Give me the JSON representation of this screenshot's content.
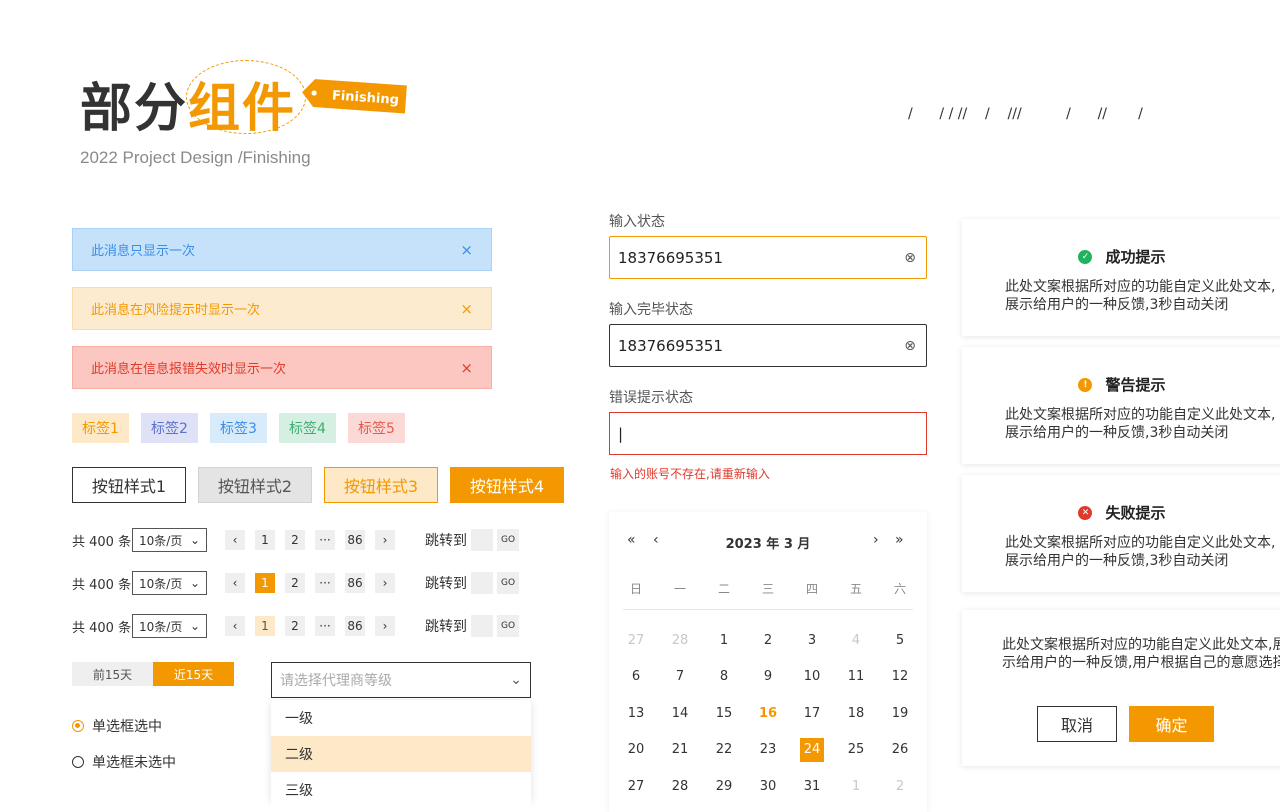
{
  "header": {
    "title_dark": "部分",
    "title_orange": "组件",
    "tag_label": "Finishing",
    "subtitle": "2022 Project Design /Finishing",
    "slashes": "/      / / //    /    ///          /      //       /"
  },
  "alerts": [
    {
      "text": "此消息只显示一次",
      "close": "×"
    },
    {
      "text": "此消息在风险提示时显示一次",
      "close": "×"
    },
    {
      "text": "此消息在信息报错失效时显示一次",
      "close": "×"
    }
  ],
  "tags": [
    "标签1",
    "标签2",
    "标签3",
    "标签4",
    "标签5"
  ],
  "buttons": [
    "按钮样式1",
    "按钮样式2",
    "按钮样式3",
    "按钮样式4"
  ],
  "pagination": {
    "total": "共 400 条",
    "page_size": "10条/页",
    "pages": [
      "1",
      "2",
      "···",
      "86"
    ],
    "prev": "‹",
    "next": "›",
    "jump_label": "跳转到",
    "go": "GO"
  },
  "segmented": [
    "前15天",
    "近15天"
  ],
  "radios": [
    {
      "label": "单选框选中",
      "checked": true
    },
    {
      "label": "单选框未选中",
      "checked": false
    }
  ],
  "select": {
    "placeholder": "请选择代理商等级",
    "options": [
      "一级",
      "二级",
      "三级"
    ],
    "highlighted": "二级"
  },
  "inputs": [
    {
      "label": "输入状态",
      "value": "18376695351",
      "state": "focus"
    },
    {
      "label": "输入完毕状态",
      "value": "18376695351",
      "state": "filled"
    },
    {
      "label": "错误提示状态",
      "value": "|",
      "state": "error",
      "error": "输入的账号不存在,请重新输入"
    }
  ],
  "calendar": {
    "title": "2023 年  3  月",
    "weekdays": [
      "日",
      "一",
      "二",
      "三",
      "四",
      "五",
      "六"
    ],
    "days": [
      [
        "27",
        "muted"
      ],
      [
        "28",
        "muted"
      ],
      [
        "1",
        ""
      ],
      [
        "2",
        ""
      ],
      [
        "3",
        ""
      ],
      [
        "4",
        "muted"
      ],
      [
        "5",
        ""
      ],
      [
        "6",
        ""
      ],
      [
        "7",
        ""
      ],
      [
        "8",
        ""
      ],
      [
        "9",
        ""
      ],
      [
        "10",
        ""
      ],
      [
        "11",
        ""
      ],
      [
        "12",
        ""
      ],
      [
        "13",
        ""
      ],
      [
        "14",
        ""
      ],
      [
        "15",
        ""
      ],
      [
        "16",
        "today"
      ],
      [
        "17",
        ""
      ],
      [
        "18",
        ""
      ],
      [
        "19",
        ""
      ],
      [
        "20",
        ""
      ],
      [
        "21",
        ""
      ],
      [
        "22",
        ""
      ],
      [
        "23",
        ""
      ],
      [
        "24",
        "selected"
      ],
      [
        "25",
        ""
      ],
      [
        "26",
        ""
      ],
      [
        "27",
        ""
      ],
      [
        "28",
        ""
      ],
      [
        "29",
        ""
      ],
      [
        "30",
        ""
      ],
      [
        "31",
        ""
      ],
      [
        "1",
        "muted"
      ],
      [
        "2",
        "muted"
      ]
    ]
  },
  "notices": [
    {
      "title": "成功提示",
      "type": "success",
      "color": "#22b35e",
      "body": "此处文案根据所对应的功能自定义此处文本,展示给用户的一种反馈,3秒自动关闭"
    },
    {
      "title": "警告提示",
      "type": "warning",
      "color": "#f39800",
      "body": "此处文案根据所对应的功能自定义此处文本,展示给用户的一种反馈,3秒自动关闭"
    },
    {
      "title": "失败提示",
      "type": "error",
      "color": "#e03a2c",
      "body": "此处文案根据所对应的功能自定义此处文本,展示给用户的一种反馈,3秒自动关闭"
    }
  ],
  "dialog": {
    "line1": "此处文案根据所对应的功能自定义此处文本,展",
    "line2": "示给用户的一种反馈,用户根据自己的意愿选择",
    "cancel": "取消",
    "confirm": "确定"
  },
  "colors": {
    "accent": "#f39800",
    "info": "#3a8ee6",
    "error": "#e03a2c",
    "success": "#22b35e"
  }
}
